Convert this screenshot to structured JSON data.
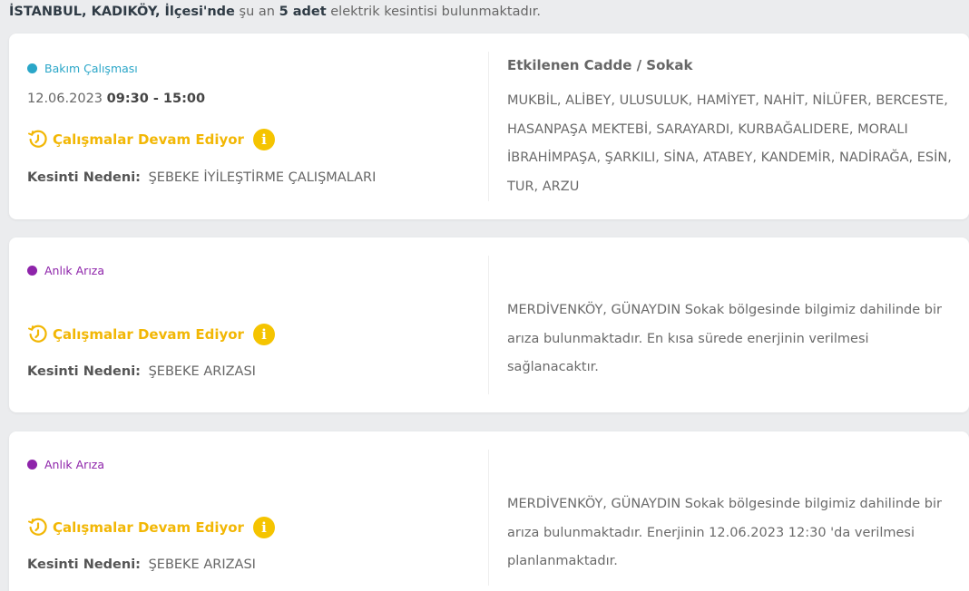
{
  "summary": {
    "location": "İSTANBUL, KADIKÖY, İlçesi'nde",
    "mid": "şu an",
    "count": "5 adet",
    "rest": "elektrik kesintisi bulunmaktadır."
  },
  "colors": {
    "maintenance": "#2aa6c8",
    "fault": "#8e24aa",
    "status": "#f2b705"
  },
  "cards": [
    {
      "type": "Bakım Çalışması",
      "date": "12.06.2023",
      "time": "09:30 - 15:00",
      "status": "Çalışmalar Devam Ediyor",
      "reason_label": "Kesinti Nedeni:",
      "reason": "ŞEBEKE İYİLEŞTİRME ÇALIŞMALARI",
      "right_title": "Etkilenen Cadde / Sokak",
      "right_text": "MUKBİL, ALİBEY, ULUSULUK, HAMİYET, NAHİT, NİLÜFER, BERCESTE, HASANPAŞA MEKTEBİ, SARAYARDI, KURBAĞALIDERE, MORALI İBRAHİMPAŞA, ŞARKILI, SİNA, ATABEY, KANDEMİR, NADİRAĞA, ESİN, TUR, ARZU"
    },
    {
      "type": "Anlık Arıza",
      "status": "Çalışmalar Devam Ediyor",
      "reason_label": "Kesinti Nedeni:",
      "reason": "ŞEBEKE ARIZASI",
      "right_text": "MERDİVENKÖY, GÜNAYDIN Sokak bölgesinde bilgimiz dahilinde bir arıza bulunmaktadır. En kısa sürede enerjinin verilmesi sağlanacaktır."
    },
    {
      "type": "Anlık Arıza",
      "status": "Çalışmalar Devam Ediyor",
      "reason_label": "Kesinti Nedeni:",
      "reason": "ŞEBEKE ARIZASI",
      "right_text": "MERDİVENKÖY, GÜNAYDIN Sokak bölgesinde bilgimiz dahilinde bir arıza bulunmaktadır. Enerjinin 12.06.2023 12:30 'da verilmesi planlanmaktadır."
    }
  ]
}
